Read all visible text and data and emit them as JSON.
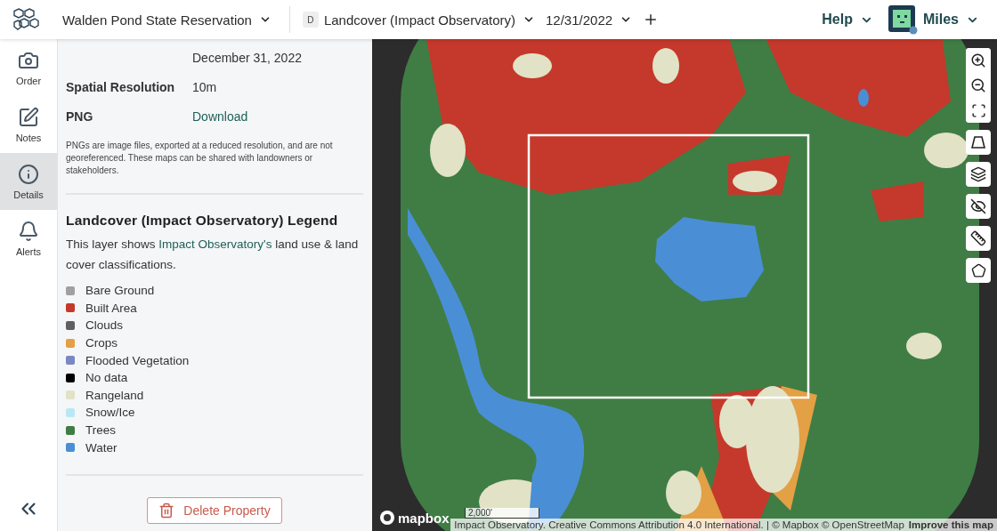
{
  "header": {
    "property": "Walden Pond State Reservation",
    "layer_badge": "D",
    "layer": "Landcover (Impact Observatory)",
    "date": "12/31/2022",
    "help": "Help",
    "user": "Miles"
  },
  "rail": [
    {
      "label": "Order",
      "selected": false
    },
    {
      "label": "Notes",
      "selected": false
    },
    {
      "label": "Details",
      "selected": true
    },
    {
      "label": "Alerts",
      "selected": false
    }
  ],
  "details": [
    {
      "value": "December 31, 2022"
    },
    {
      "label": "Spatial Resolution",
      "value": "10m"
    },
    {
      "label": "PNG",
      "value": "Download",
      "kind": "link"
    }
  ],
  "png_note": "PNGs are image files, exported at a reduced resolution, and are not georeferenced. These maps can be shared with landowners or stakeholders.",
  "legend": {
    "title": "Landcover (Impact Observatory) Legend",
    "intro_before": "This layer shows ",
    "intro_link": "Impact Observatory's",
    "intro_after": " land use & land cover classifications.",
    "items": [
      {
        "label": "Bare Ground",
        "color": "#a0a0a0"
      },
      {
        "label": "Built Area",
        "color": "#c4392b"
      },
      {
        "label": "Clouds",
        "color": "#5f6062"
      },
      {
        "label": "Crops",
        "color": "#e3a044"
      },
      {
        "label": "Flooded Vegetation",
        "color": "#7b86c4"
      },
      {
        "label": "No data",
        "color": "#000000"
      },
      {
        "label": "Rangeland",
        "color": "#e2e2c6"
      },
      {
        "label": "Snow/Ice",
        "color": "#b8e8f5"
      },
      {
        "label": "Trees",
        "color": "#3f7d45"
      },
      {
        "label": "Water",
        "color": "#4a8fd6"
      }
    ]
  },
  "delete_button": "Delete Property",
  "map": {
    "scale": "2,000'",
    "logo": "mapbox",
    "attribution": "Impact Observatory. Creative Commons Attribution 4.0 International. | © Mapbox © OpenStreetMap",
    "improve": "Improve this map"
  }
}
